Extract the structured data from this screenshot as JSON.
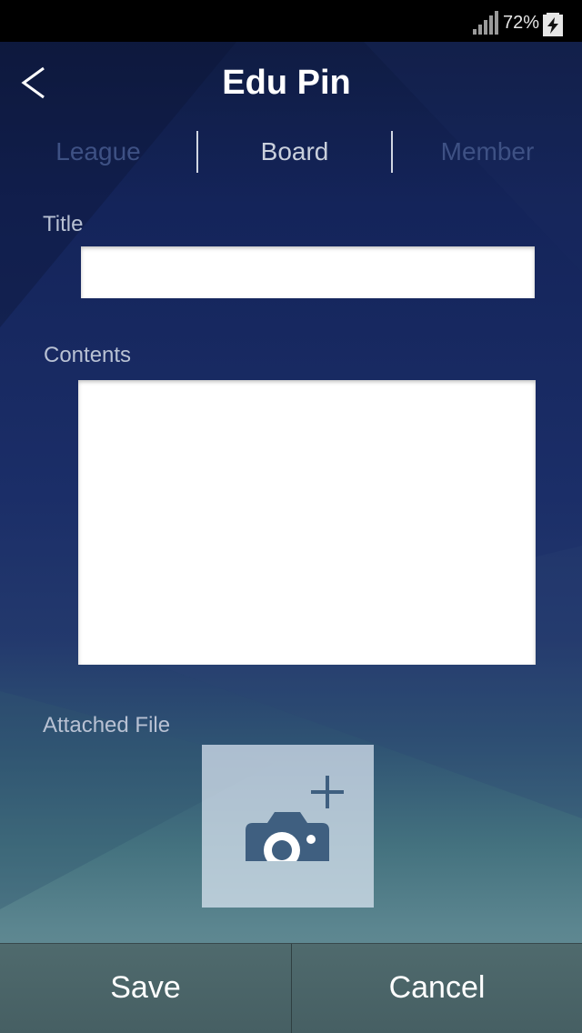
{
  "status_bar": {
    "battery_percent": "72%",
    "signal_icon": "cellular-signal-icon",
    "battery_icon": "battery-charging-icon"
  },
  "header": {
    "back_icon": "chevron-left-icon",
    "title": "Edu Pin"
  },
  "tabs": [
    {
      "label": "League",
      "active": false
    },
    {
      "label": "Board",
      "active": true
    },
    {
      "label": "Member",
      "active": false
    }
  ],
  "form": {
    "title_label": "Title",
    "title_value": "",
    "contents_label": "Contents",
    "contents_value": "",
    "attached_label": "Attached File",
    "attach_icon": "camera-add-icon"
  },
  "actions": {
    "save_label": "Save",
    "cancel_label": "Cancel"
  },
  "colors": {
    "accent_text": "#ffffff",
    "inactive_tab": "#3e5184",
    "bottom_bar": "#4f6a6d",
    "camera": "#3f5f80"
  }
}
